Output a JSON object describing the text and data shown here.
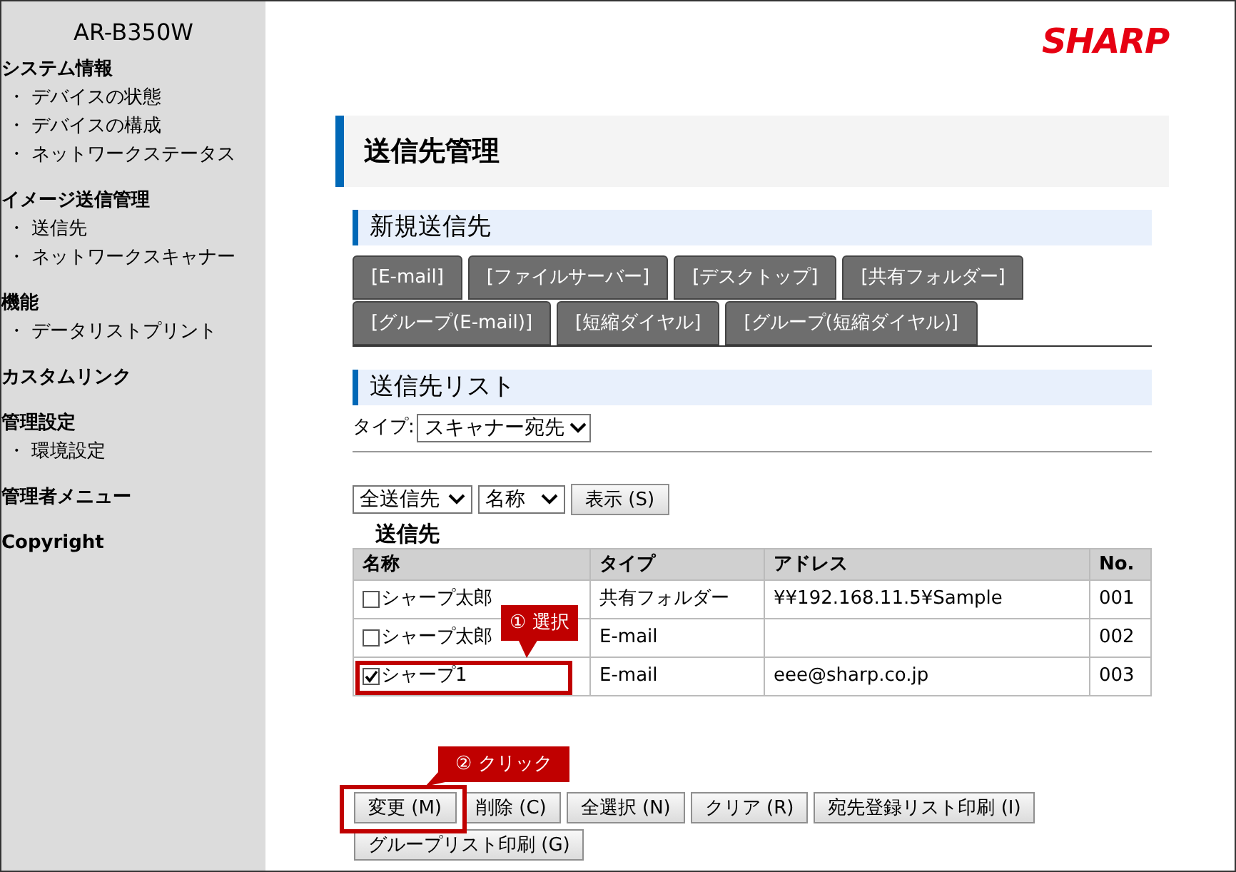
{
  "sidebar": {
    "title": "AR-B350W",
    "sections": [
      {
        "heading": "システム情報",
        "items": [
          "・ デバイスの状態",
          "・ デバイスの構成",
          "・ ネットワークステータス"
        ]
      },
      {
        "heading": "イメージ送信管理",
        "items": [
          "・ 送信先",
          "・ ネットワークスキャナー"
        ]
      },
      {
        "heading": "機能",
        "items": [
          "・ データリストプリント"
        ]
      },
      {
        "heading": "カスタムリンク"
      },
      {
        "heading": "管理設定",
        "items": [
          "・ 環境設定"
        ]
      },
      {
        "heading": "管理者メニュー"
      },
      {
        "heading": "Copyright"
      }
    ]
  },
  "logo": "SHARP",
  "page_title": "送信先管理",
  "new_destination": {
    "heading": "新規送信先",
    "tab_rows": [
      [
        "[E-mail]",
        "[ファイルサーバー]",
        "[デスクトップ]",
        "[共有フォルダー]"
      ],
      [
        "[グループ(E-mail)]",
        "[短縮ダイヤル]",
        "[グループ(短縮ダイヤル)]"
      ]
    ]
  },
  "destination_list": {
    "heading": "送信先リスト",
    "type_label": "タイプ:",
    "type_select": "スキャナー宛先",
    "filters": [
      "全送信先",
      "名称"
    ],
    "show_button": "表示 (S)",
    "table": {
      "caption": "送信先",
      "columns": [
        "名称",
        "タイプ",
        "アドレス",
        "No."
      ],
      "rows": [
        {
          "checked": false,
          "cells": [
            "シャープ太郎",
            "共有フォルダー",
            "¥¥192.168.11.5¥Sample",
            "001"
          ]
        },
        {
          "checked": false,
          "cells": [
            "シャープ太郎",
            "E-mail",
            "",
            "002"
          ]
        },
        {
          "checked": true,
          "cells": [
            "シャープ1",
            "E-mail",
            "eee@sharp.co.jp",
            "003"
          ]
        }
      ]
    }
  },
  "buttons": [
    "変更 (M)",
    "削除 (C)",
    "全選択 (N)",
    "クリア (R)",
    "宛先登録リスト印刷 (I)",
    "グループリスト印刷 (G)"
  ],
  "callouts": [
    {
      "label": "① 選択"
    },
    {
      "label": "② クリック"
    }
  ]
}
